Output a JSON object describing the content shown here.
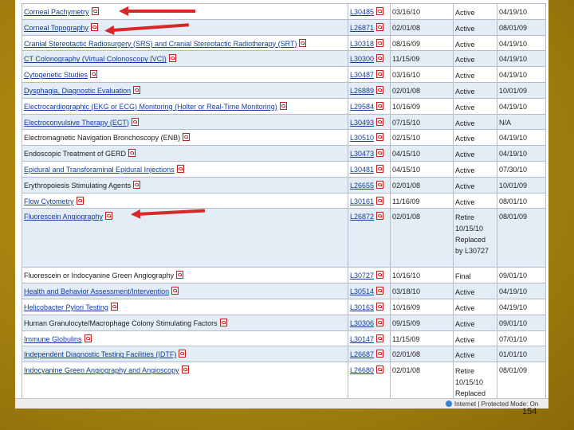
{
  "rows": [
    {
      "title": "Corneal Pachymetry",
      "linked": true,
      "id": "L30485",
      "date": "03/16/10",
      "status": "Active",
      "effective": "04/19/10"
    },
    {
      "title": "Corneal Topography",
      "linked": true,
      "id": "L26871",
      "date": "02/01/08",
      "status": "Active",
      "effective": "08/01/09"
    },
    {
      "title": "Cranial Stereotactic Radiosurgery (SRS) and Cranial Stereotactic Radiotherapy (SRT)",
      "linked": true,
      "id": "L30318",
      "date": "08/16/09",
      "status": "Active",
      "effective": "04/19/10"
    },
    {
      "title": "CT Colonography (Virtual Colonoscopy [VC])",
      "linked": true,
      "id": "L30300",
      "date": "11/15/09",
      "status": "Active",
      "effective": "04/19/10"
    },
    {
      "title": "Cytogenetic Studies",
      "linked": true,
      "id": "L30487",
      "date": "03/16/10",
      "status": "Active",
      "effective": "04/19/10"
    },
    {
      "title": "Dysphagia, Diagnostic Evaluation",
      "linked": true,
      "id": "L26889",
      "date": "02/01/08",
      "status": "Active",
      "effective": "10/01/09"
    },
    {
      "title": "Electrocardiographic (EKG or ECG) Monitoring (Holter or Real-Time Monitoring)",
      "linked": true,
      "id": "L29584",
      "date": "10/16/09",
      "status": "Active",
      "effective": "04/19/10"
    },
    {
      "title": "Electroconvulsive Therapy (ECT)",
      "linked": true,
      "id": "L30493",
      "date": "07/15/10",
      "status": "Active",
      "effective": "N/A"
    },
    {
      "title": "Electromagnetic Navigation Bronchoscopy (ENB)",
      "linked": false,
      "id": "L30510",
      "date": "02/15/10",
      "status": "Active",
      "effective": "04/19/10"
    },
    {
      "title": "Endoscopic Treatment of GERD",
      "linked": false,
      "id": "L30473",
      "date": "04/15/10",
      "status": "Active",
      "effective": "04/19/10"
    },
    {
      "title": "Epidural and Transforaminal Epidural Injections",
      "linked": true,
      "id": "L30481",
      "date": "04/15/10",
      "status": "Active",
      "effective": "07/30/10"
    },
    {
      "title": "Erythropoiesis Stimulating Agents",
      "linked": false,
      "id": "L26655",
      "date": "02/01/08",
      "status": "Active",
      "effective": "10/01/09"
    },
    {
      "title": "Flow Cytometry",
      "linked": true,
      "id": "L30161",
      "date": "11/16/09",
      "status": "Active",
      "effective": "08/01/10"
    },
    {
      "title": "Fluorescein Angiography",
      "linked": true,
      "id": "L26872",
      "date": "02/01/08",
      "status": "Retire 10/15/10 Replaced by L30727",
      "effective": "08/01/09",
      "tall": true
    },
    {
      "title": "Fluorescein or Indocyanine Green Angiography",
      "linked": false,
      "id": "L30727",
      "date": "10/16/10",
      "status": "Final",
      "effective": "09/01/10"
    },
    {
      "title": "Health and Behavior Assessment/Intervention",
      "linked": true,
      "id": "L30514",
      "date": "03/18/10",
      "status": "Active",
      "effective": "04/19/10"
    },
    {
      "title": "Helicobacter Pylori Testing",
      "linked": true,
      "id": "L30163",
      "date": "10/16/09",
      "status": "Active",
      "effective": "04/19/10"
    },
    {
      "title": "Human Granulocyte/Macrophage Colony Stimulating Factors",
      "linked": false,
      "id": "L30306",
      "date": "09/15/09",
      "status": "Active",
      "effective": "09/01/10"
    },
    {
      "title": "Immune Globulins",
      "linked": true,
      "id": "L30147",
      "date": "11/15/09",
      "status": "Active",
      "effective": "07/01/10"
    },
    {
      "title": "Independent Diagnostic Testing Facilities (IDTF)",
      "linked": true,
      "id": "L26687",
      "date": "02/01/08",
      "status": "Active",
      "effective": "01/01/10"
    },
    {
      "title": "Indocyanine Green Angiography and Angioscopy",
      "linked": true,
      "id": "L26680",
      "date": "02/01/08",
      "status": "Retire 10/15/10 Replaced",
      "effective": "08/01/09",
      "tall": true
    }
  ],
  "statusbar": {
    "text": "Internet | Protected Mode: On"
  },
  "slide": {
    "page_number": "154"
  },
  "colors": {
    "link": "#123e99",
    "arrow": "#d62828",
    "row_alt": "#e4ecf5",
    "slide_bg": "#a88612"
  },
  "icons": {
    "document": "pdf-icon",
    "zone": "globe-icon"
  }
}
